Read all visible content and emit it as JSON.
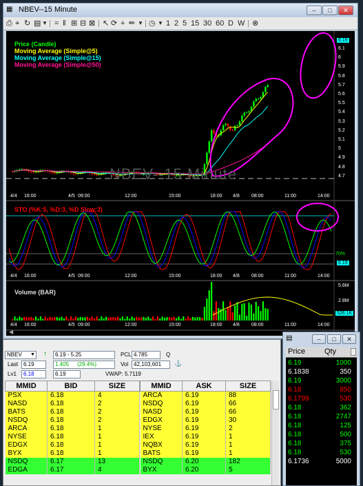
{
  "window": {
    "title": "NBEV--15 Minute"
  },
  "toolbar": {
    "periods": [
      "1",
      "2",
      "5",
      "15",
      "30",
      "60",
      "D",
      "W"
    ]
  },
  "colors": {
    "price_up": "#00ff00",
    "price_down": "#ff0000",
    "ma5": "#ffff00",
    "ma15": "#00ffff",
    "ma50": "#ff1493",
    "stoch_k": "#ff0000",
    "stoch_d": "#0000ff",
    "stoch_slow": "#00ff00",
    "annotation": "#ff00ff",
    "highlight_yellow": "#ffff33",
    "highlight_green": "#33ff33"
  },
  "price_panel": {
    "legend": [
      "Price (Candle)",
      "Moving Average (Simple@5)",
      "Moving Average (Simple@15)",
      "Moving Average (Simple@50)"
    ],
    "watermark": "NBEV--15 Minute",
    "price_axis": [
      "6.19",
      "6.1",
      "6",
      "5.9",
      "5.8",
      "5.7",
      "5.6",
      "5.5",
      "5.4",
      "5.3",
      "5.2",
      "5.1",
      "5",
      "4.9",
      "4.8",
      "4.7"
    ],
    "last_tag": "6.19",
    "time_labels": [
      "4/4",
      "16:00",
      "4/5",
      "09:00",
      "12:00",
      "15:00",
      "18:00",
      "4/8",
      "08:00",
      "11:00",
      "14:00"
    ]
  },
  "stoch_panel": {
    "legend": "STO (%K:5, %D:3, %D Slow:3)",
    "level_label": "70%",
    "last_tag": "6.19",
    "time_labels": [
      "4/4",
      "16:00",
      "4/5",
      "09:00",
      "12:00",
      "15:00",
      "18:00",
      "4/8",
      "08:00",
      "11:00",
      "14:00"
    ]
  },
  "volume_panel": {
    "legend": "Volume (BAR)",
    "axis": [
      "5.6M",
      "2.8M"
    ],
    "last_tag": "526.1K",
    "time_labels": [
      "4/4",
      "16:00",
      "4/5",
      "09:00",
      "12:00",
      "15:00",
      "18:00",
      "4/8",
      "08:00",
      "11:00",
      "14:00"
    ]
  },
  "level2": {
    "symbol": "NBEV",
    "range": "6.19 - 5.25",
    "pcl_label": "PCL",
    "pcl": "4.785",
    "q_label": "Q",
    "last_label": "Last",
    "last": "6.19",
    "change": "1.405",
    "change_pct": "(29.4%)",
    "vol_label": "Vol",
    "volume": "42,103,601",
    "lv1_label": "Lv1",
    "lv1_bid": "6.18",
    "lv1_ask": "6.19",
    "vwap_label": "VWAP:",
    "vwap": "5.7119",
    "bid_headers": [
      "MMID",
      "BID",
      "SIZE"
    ],
    "ask_headers": [
      "MMID",
      "ASK",
      "SIZE"
    ],
    "bids": [
      {
        "mmid": "PSX",
        "price": "6.18",
        "size": "4"
      },
      {
        "mmid": "NASD",
        "price": "6.18",
        "size": "2"
      },
      {
        "mmid": "BATS",
        "price": "6.18",
        "size": "2"
      },
      {
        "mmid": "NSDQ",
        "price": "6.18",
        "size": "2"
      },
      {
        "mmid": "ARCA",
        "price": "6.18",
        "size": "1"
      },
      {
        "mmid": "NYSE",
        "price": "6.18",
        "size": "1"
      },
      {
        "mmid": "EDGX",
        "price": "6.18",
        "size": "1"
      },
      {
        "mmid": "BYX",
        "price": "6.18",
        "size": "1"
      },
      {
        "mmid": "NSDQ",
        "price": "6.17",
        "size": "13"
      },
      {
        "mmid": "EDGA",
        "price": "6.17",
        "size": "4"
      }
    ],
    "asks": [
      {
        "mmid": "ARCA",
        "price": "6.19",
        "size": "88"
      },
      {
        "mmid": "NSDQ",
        "price": "6.19",
        "size": "66"
      },
      {
        "mmid": "NASD",
        "price": "6.19",
        "size": "66"
      },
      {
        "mmid": "EDGX",
        "price": "6.19",
        "size": "30"
      },
      {
        "mmid": "NYSE",
        "price": "6.19",
        "size": "2"
      },
      {
        "mmid": "IEX",
        "price": "6.19",
        "size": "1"
      },
      {
        "mmid": "NQBX",
        "price": "6.19",
        "size": "1"
      },
      {
        "mmid": "BATS",
        "price": "6.19",
        "size": "1"
      },
      {
        "mmid": "NSDQ",
        "price": "6.20",
        "size": "182"
      },
      {
        "mmid": "BYX",
        "price": "6.20",
        "size": "5"
      }
    ]
  },
  "time_sales": {
    "headers": [
      "Price",
      "Qty"
    ],
    "rows": [
      {
        "price": "6.19",
        "qty": "1000",
        "color": "#00ff00"
      },
      {
        "price": "6.1838",
        "qty": "350",
        "color": "#ffffff"
      },
      {
        "price": "6.19",
        "qty": "3000",
        "color": "#00ff00"
      },
      {
        "price": "6.18",
        "qty": "850",
        "color": "#ff0000"
      },
      {
        "price": "6.1799",
        "qty": "530",
        "color": "#ff0000"
      },
      {
        "price": "6.18",
        "qty": "362",
        "color": "#00ff00"
      },
      {
        "price": "6.18",
        "qty": "2747",
        "color": "#00ff00"
      },
      {
        "price": "6.18",
        "qty": "125",
        "color": "#00ff00"
      },
      {
        "price": "6.18",
        "qty": "500",
        "color": "#00ff00"
      },
      {
        "price": "6.18",
        "qty": "375",
        "color": "#00ff00"
      },
      {
        "price": "6.18",
        "qty": "530",
        "color": "#00ff00"
      },
      {
        "price": "6.1736",
        "qty": "5000",
        "color": "#ffffff"
      }
    ]
  }
}
